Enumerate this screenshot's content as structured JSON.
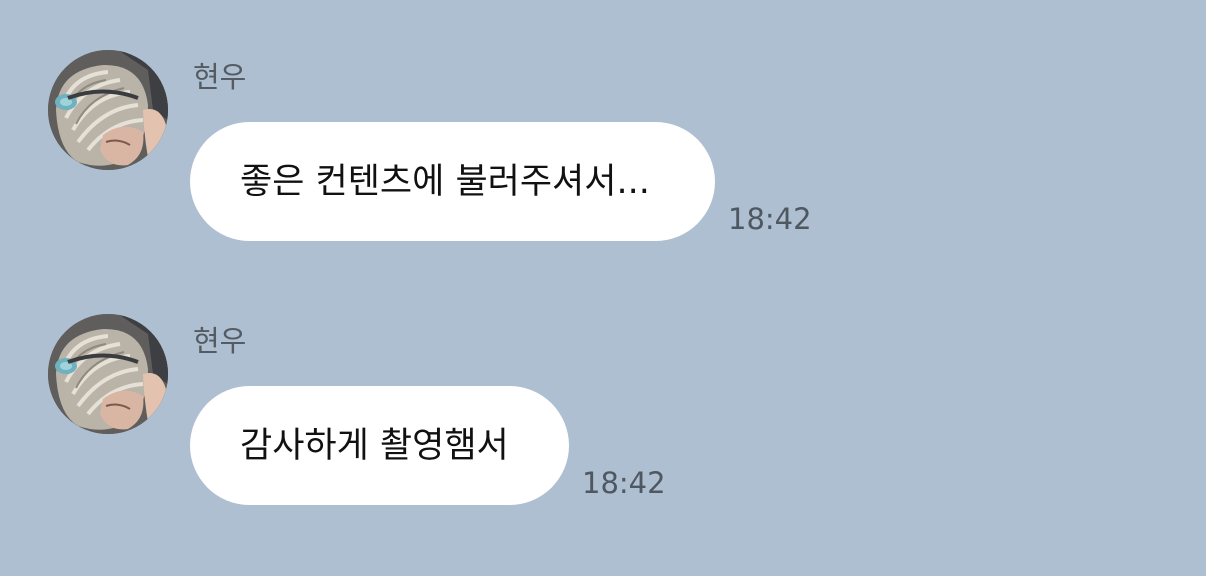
{
  "chat": {
    "background_color": "#adbfd1",
    "messages": [
      {
        "sender": "현우",
        "text": "좋은 컨텐츠에 불러주셔서...",
        "time": "18:42",
        "avatar_icon": "profile-photo-avatar"
      },
      {
        "sender": "현우",
        "text": "감사하게 촬영햄서",
        "time": "18:42",
        "avatar_icon": "profile-photo-avatar"
      }
    ]
  }
}
